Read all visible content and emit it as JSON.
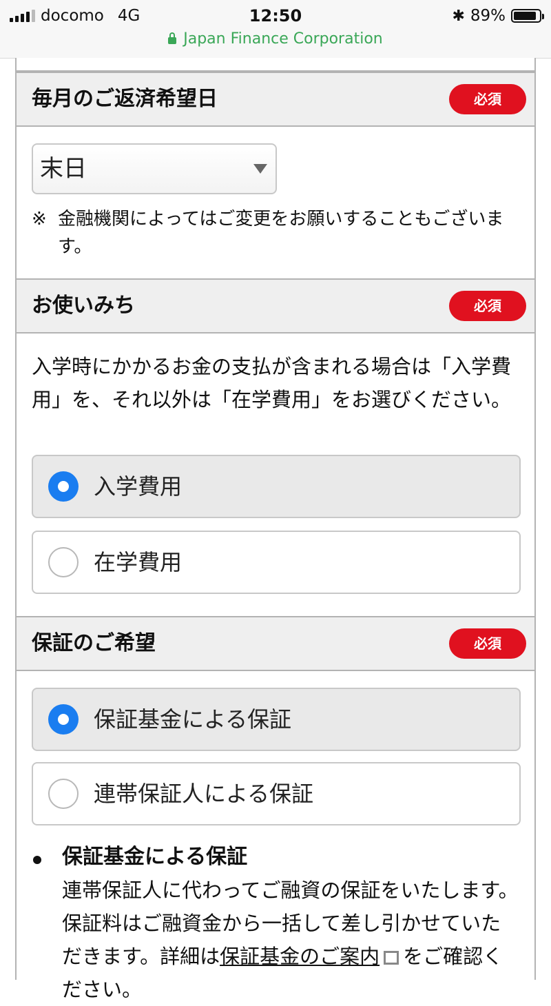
{
  "status_bar": {
    "carrier": "docomo",
    "network": "4G",
    "time": "12:50",
    "battery": "89%",
    "battery_level": 0.89
  },
  "browser": {
    "site_name": "Japan Finance Corporation"
  },
  "form": {
    "repayment_day": {
      "title": "毎月のご返済希望日",
      "required_badge": "必須",
      "selected_value": "末日",
      "note_mark": "※",
      "note_text": "金融機関によってはご変更をお願いすることもございます。"
    },
    "purpose": {
      "title": "お使いみち",
      "required_badge": "必須",
      "description": "入学時にかかるお金の支払が含まれる場合は「入学費用」を、それ以外は「在学費用」をお選びください。",
      "options": [
        {
          "label": "入学費用",
          "checked": true
        },
        {
          "label": "在学費用",
          "checked": false
        }
      ]
    },
    "guarantee": {
      "title": "保証のご希望",
      "required_badge": "必須",
      "options": [
        {
          "label": "保証基金による保証",
          "checked": true
        },
        {
          "label": "連帯保証人による保証",
          "checked": false
        }
      ],
      "info_title": "保証基金による保証",
      "info_body": "連帯保証人に代わってご融資の保証をいたします。保証料はご融資金から一括して差し引かせていただきます。詳細は",
      "info_link": "保証基金のご案内",
      "info_tail": "をご確認ください。"
    }
  }
}
